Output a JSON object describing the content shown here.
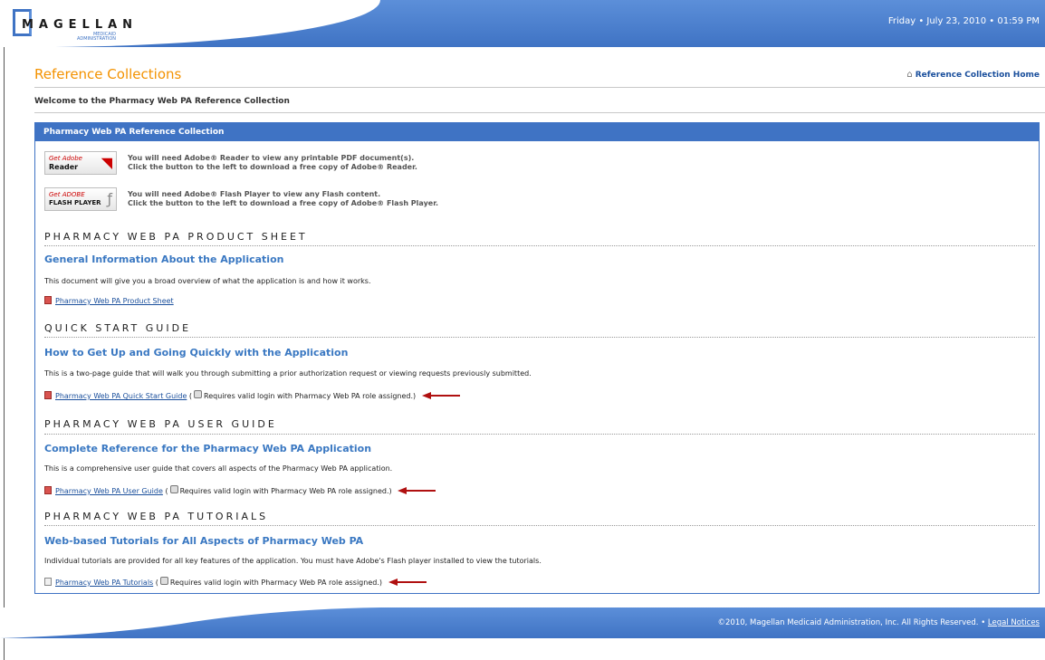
{
  "header": {
    "logo_name": "MAGELLAN",
    "logo_sub": "MEDICAID\nADMINISTRATION",
    "datetime": "Friday • July 23, 2010 • 01:59 PM"
  },
  "page": {
    "title": "Reference Collections",
    "home_link": "Reference Collection Home",
    "welcome": "Welcome to the Pharmacy Web PA Reference Collection"
  },
  "panel": {
    "title": "Pharmacy Web PA Reference Collection",
    "downloads": [
      {
        "badge_line1": "Get Adobe",
        "badge_line2": "Reader",
        "line1": "You will need Adobe® Reader to view any printable PDF document(s).",
        "line2": "Click the button to the left to download a free copy of Adobe® Reader."
      },
      {
        "badge_line1": "Get ADOBE",
        "badge_line2": "FLASH PLAYER",
        "line1": "You will need Adobe® Flash Player to view any Flash content.",
        "line2": "Click the button to the left to download a free copy of Adobe® Flash Player."
      }
    ],
    "sections": [
      {
        "title": "PHARMACY WEB PA PRODUCT SHEET",
        "subhead": "General Information About the Application",
        "desc": "This document will give you a broad overview of what the application is and how it works.",
        "link": "Pharmacy Web PA Product Sheet",
        "note": ""
      },
      {
        "title": "QUICK START GUIDE",
        "subhead": "How to Get Up and Going Quickly with the Application",
        "desc": "This is a two-page guide that will walk you through submitting a prior authorization request or viewing requests previously submitted.",
        "link": "Pharmacy Web PA Quick Start Guide",
        "note": "Requires valid login with Pharmacy Web PA role assigned.)"
      },
      {
        "title": "PHARMACY WEB PA USER GUIDE",
        "subhead": "Complete Reference for the Pharmacy Web PA Application",
        "desc": "This is a comprehensive user guide that covers all aspects of the Pharmacy Web PA application.",
        "link": "Pharmacy Web PA User Guide",
        "note": "Requires valid login with Pharmacy Web PA role assigned.)"
      },
      {
        "title": "PHARMACY WEB PA TUTORIALS",
        "subhead": "Web-based Tutorials for All Aspects of Pharmacy Web PA",
        "desc": "Individual tutorials are provided for all key features of the application. You must have Adobe's Flash player installed to view the tutorials.",
        "link": "Pharmacy Web PA Tutorials",
        "note": "Requires valid login with Pharmacy Web PA role assigned.)"
      }
    ]
  },
  "footer": {
    "copyright": "©2010, Magellan Medicaid Administration, Inc. All Rights Reserved. •",
    "legal": "Legal Notices"
  },
  "colors": {
    "brand_blue": "#3f73c4",
    "title_orange": "#f39200",
    "arrow_red": "#b01010"
  }
}
